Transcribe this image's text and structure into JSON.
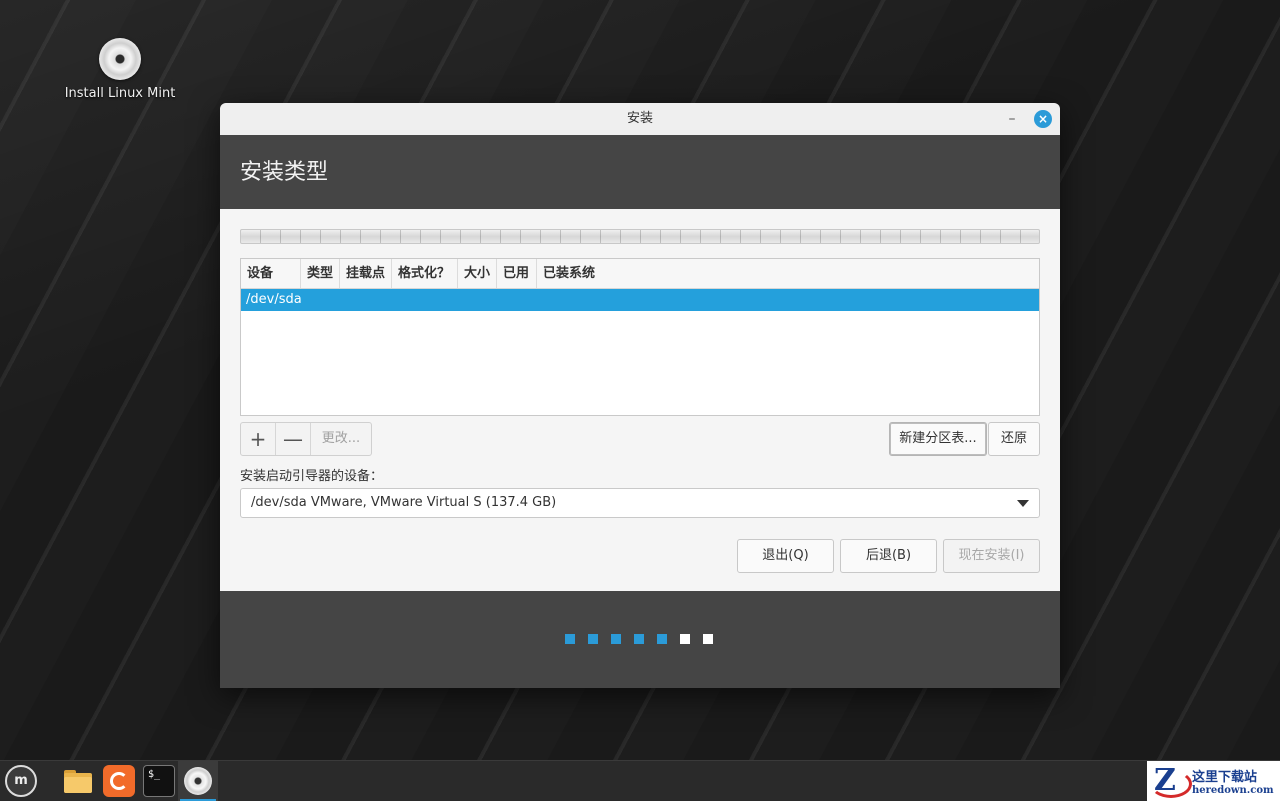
{
  "desktop": {
    "icon_label": "Install Linux Mint"
  },
  "window": {
    "title": "安装",
    "minimize_glyph": "–",
    "close_glyph": "×",
    "header": "安装类型",
    "table": {
      "columns": [
        "设备",
        "类型",
        "挂载点",
        "格式化？",
        "大小",
        "已用",
        "已装系统"
      ],
      "rows": [
        "/dev/sda"
      ]
    },
    "partition_buttons": {
      "add": "+",
      "remove": "—",
      "change": "更改..."
    },
    "new_partition_table": "新建分区表...",
    "revert": "还原",
    "bootloader_label": "安装启动引导器的设备：",
    "bootloader_device": "/dev/sda VMware, VMware Virtual S (137.4 GB)",
    "quit": "退出(Q)",
    "back": "后退(B)",
    "install_now": "现在安装(I)",
    "progress": {
      "completed_steps": 5,
      "total_steps": 7
    }
  },
  "colors": {
    "accent": "#24a0dc",
    "step_done": "#2b9bd8",
    "step_todo": "#ffffff"
  },
  "taskbar": {
    "icons": [
      "mint-menu-icon",
      "files-icon",
      "firefox-icon",
      "terminal-icon",
      "installer-icon"
    ],
    "mint_glyph": "m",
    "terminal_glyph": "$_"
  },
  "watermark": {
    "cn": "这里下载站",
    "en": "heredown.com"
  }
}
